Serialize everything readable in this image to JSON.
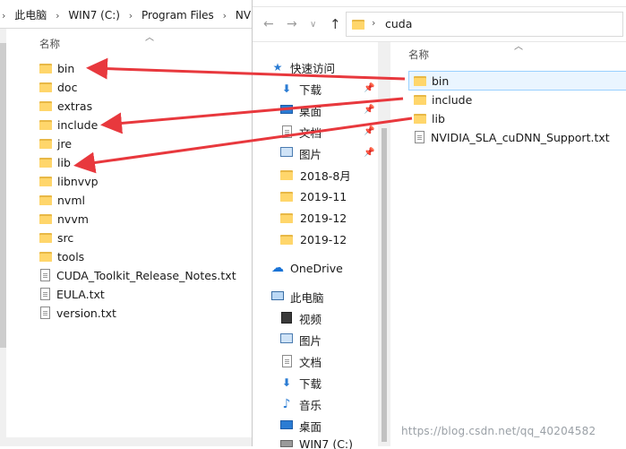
{
  "left_window": {
    "breadcrumb": [
      "此电脑",
      "WIN7 (C:)",
      "Program Files",
      "NV"
    ],
    "column_header": "名称",
    "items": [
      {
        "name": "bin",
        "type": "folder"
      },
      {
        "name": "doc",
        "type": "folder"
      },
      {
        "name": "extras",
        "type": "folder"
      },
      {
        "name": "include",
        "type": "folder"
      },
      {
        "name": "jre",
        "type": "folder"
      },
      {
        "name": "lib",
        "type": "folder"
      },
      {
        "name": "libnvvp",
        "type": "folder"
      },
      {
        "name": "nvml",
        "type": "folder"
      },
      {
        "name": "nvvm",
        "type": "folder"
      },
      {
        "name": "src",
        "type": "folder"
      },
      {
        "name": "tools",
        "type": "folder"
      },
      {
        "name": "CUDA_Toolkit_Release_Notes.txt",
        "type": "file"
      },
      {
        "name": "EULA.txt",
        "type": "file"
      },
      {
        "name": "version.txt",
        "type": "file"
      }
    ]
  },
  "right_window": {
    "address": "cuda",
    "column_header": "名称",
    "items": [
      {
        "name": "bin",
        "type": "folder"
      },
      {
        "name": "include",
        "type": "folder"
      },
      {
        "name": "lib",
        "type": "folder"
      },
      {
        "name": "NVIDIA_SLA_cuDNN_Support.txt",
        "type": "file"
      }
    ],
    "nav": {
      "quick_access": "快速访问",
      "quick_items": [
        {
          "label": "下载",
          "icon": "download-icon",
          "pinned": true
        },
        {
          "label": "桌面",
          "icon": "desktop-icon",
          "pinned": true
        },
        {
          "label": "文档",
          "icon": "document-icon",
          "pinned": true
        },
        {
          "label": "图片",
          "icon": "picture-icon",
          "pinned": true
        },
        {
          "label": "2018-8月",
          "icon": "folder-icon",
          "pinned": false
        },
        {
          "label": "2019-11",
          "icon": "folder-icon",
          "pinned": false
        },
        {
          "label": "2019-12",
          "icon": "folder-icon",
          "pinned": false
        },
        {
          "label": "2019-12",
          "icon": "folder-icon",
          "pinned": false
        }
      ],
      "onedrive": "OneDrive",
      "this_pc": "此电脑",
      "pc_items": [
        {
          "label": "视频",
          "icon": "video-icon"
        },
        {
          "label": "图片",
          "icon": "picture-icon"
        },
        {
          "label": "文档",
          "icon": "document-icon"
        },
        {
          "label": "下载",
          "icon": "download-icon"
        },
        {
          "label": "音乐",
          "icon": "music-icon"
        },
        {
          "label": "桌面",
          "icon": "desktop-icon"
        },
        {
          "label": "WIN7 (C:)",
          "icon": "drive-icon"
        }
      ]
    }
  },
  "watermark": "https://blog.csdn.net/qq_40204582",
  "colors": {
    "arrow": "#e8383d",
    "folder": "#ffd66b",
    "selection_border": "#99d1ff",
    "selection_fill": "#eaf5ff",
    "onedrive": "#1a73d6"
  }
}
